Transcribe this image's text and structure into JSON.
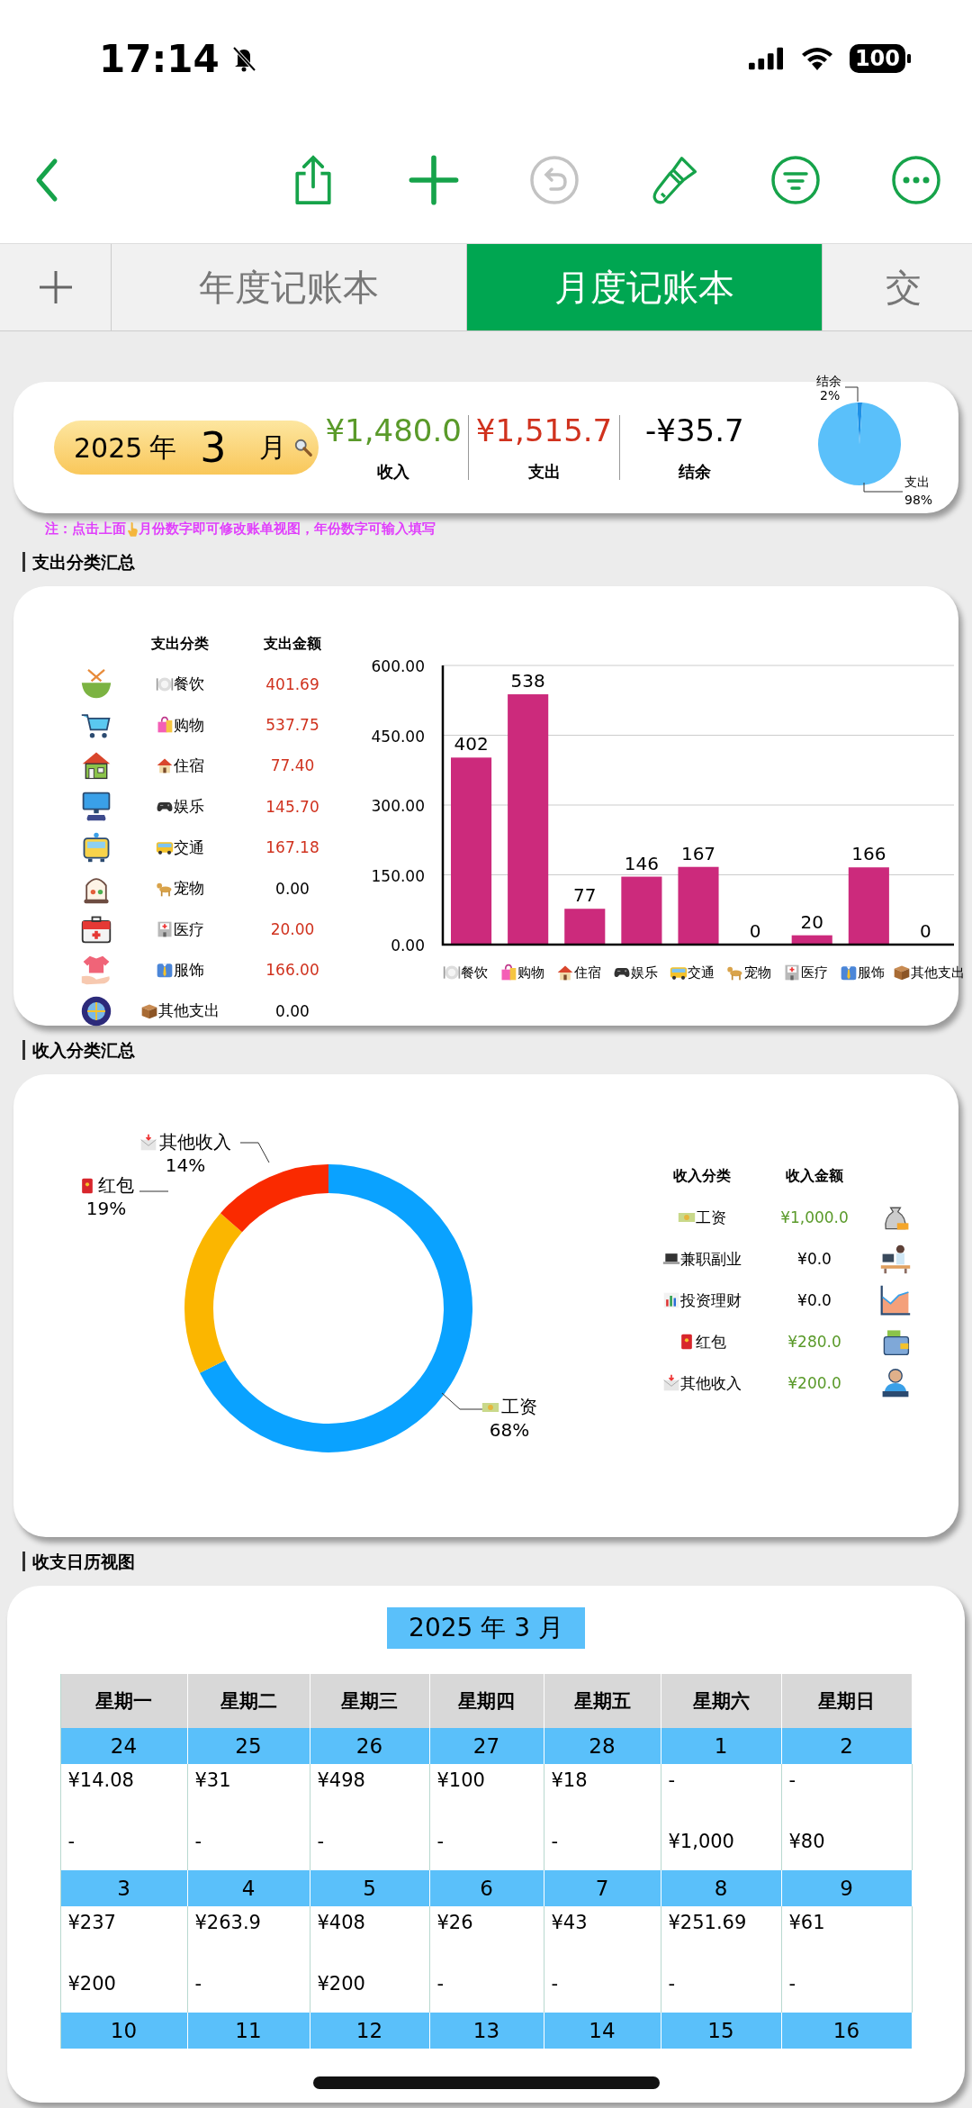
{
  "status_bar": {
    "time": "17:14",
    "battery": "100"
  },
  "toolbar": [
    {
      "kind": "back",
      "disabled": false
    },
    {
      "kind": "share",
      "disabled": false
    },
    {
      "kind": "add",
      "disabled": false
    },
    {
      "kind": "undo",
      "disabled": true
    },
    {
      "kind": "brush",
      "disabled": false
    },
    {
      "kind": "filter",
      "disabled": false
    },
    {
      "kind": "more",
      "disabled": false
    }
  ],
  "tabs": [
    {
      "kind": "add",
      "selected": false
    },
    {
      "kind": "sheet",
      "label": "年度记账本",
      "selected": false
    },
    {
      "kind": "sheet",
      "label": "月度记账本",
      "selected": true
    },
    {
      "kind": "sheet",
      "label": "交",
      "selected": false
    }
  ],
  "summary": {
    "year": "2025",
    "year_unit": "年",
    "month": "3",
    "month_unit": "月",
    "totals": [
      {
        "kind": "income",
        "value": "¥1,480.0",
        "label": "收入"
      },
      {
        "kind": "expense",
        "value": "¥1,515.7",
        "label": "支出"
      },
      {
        "kind": "balance",
        "value": "-¥35.7",
        "label": "结余"
      }
    ],
    "chart_data": {
      "type": "pie",
      "categories": [
        "结余",
        "支出"
      ],
      "values": [
        2,
        98
      ],
      "colors": [
        "#1e90e6",
        "#5ac0fa"
      ],
      "value_labels": [
        "2%",
        "98%"
      ]
    }
  },
  "note": {
    "before": "注：点击上面",
    "after": "月份数字即可修改账单视图，年份数字可输入填写"
  },
  "expense_section": {
    "title": "支出分类汇总",
    "columns": [
      "支出分类",
      "支出金额"
    ],
    "rows": [
      {
        "category": "餐饮",
        "amount": "401.69",
        "highlight": true
      },
      {
        "category": "购物",
        "amount": "537.75",
        "highlight": true
      },
      {
        "category": "住宿",
        "amount": "77.40",
        "highlight": true
      },
      {
        "category": "娱乐",
        "amount": "145.70",
        "highlight": true
      },
      {
        "category": "交通",
        "amount": "167.18",
        "highlight": true
      },
      {
        "category": "宠物",
        "amount": "0.00",
        "highlight": false
      },
      {
        "category": "医疗",
        "amount": "20.00",
        "highlight": true
      },
      {
        "category": "服饰",
        "amount": "166.00",
        "highlight": true
      },
      {
        "category": "其他支出",
        "amount": "0.00",
        "highlight": false
      }
    ],
    "chart_data": {
      "type": "bar",
      "categories": [
        "餐饮",
        "购物",
        "住宿",
        "娱乐",
        "交通",
        "宠物",
        "医疗",
        "服饰",
        "其他支出"
      ],
      "series": [
        {
          "color": "#cc2a7c",
          "values": [
            402,
            538,
            77,
            146,
            167,
            0,
            20,
            166,
            0
          ]
        }
      ],
      "grid": true,
      "value_labels": [
        "402",
        "538",
        "77",
        "146",
        "167",
        "0",
        "20",
        "166",
        "0"
      ],
      "ylim": [
        0,
        600
      ],
      "yticks": [
        {
          "value": 0,
          "label": "0.00"
        },
        {
          "value": 150,
          "label": "150.00"
        },
        {
          "value": 300,
          "label": "300.00"
        },
        {
          "value": 450,
          "label": "450.00"
        },
        {
          "value": 600,
          "label": "600.00"
        }
      ]
    }
  },
  "income_section": {
    "title": "收入分类汇总",
    "columns": [
      "收入分类",
      "收入金额"
    ],
    "rows": [
      {
        "category": "工资",
        "amount": "¥1,000.0",
        "highlight": true
      },
      {
        "category": "兼职副业",
        "amount": "¥0.0",
        "highlight": false
      },
      {
        "category": "投资理财",
        "amount": "¥0.0",
        "highlight": false
      },
      {
        "category": "红包",
        "amount": "¥280.0",
        "highlight": true
      },
      {
        "category": "其他收入",
        "amount": "¥200.0",
        "highlight": true
      }
    ],
    "chart_data": {
      "type": "donut",
      "categories": [
        "工资",
        "红包",
        "其他收入"
      ],
      "series": [
        {
          "values": [
            67.6,
            18.9,
            13.5
          ]
        }
      ],
      "colors": [
        "#0aa2ff",
        "#fbb600",
        "#fa2a00"
      ],
      "value_labels": [
        "68%",
        "19%",
        "14%"
      ]
    }
  },
  "calendar_section": {
    "title": "收支日历视图",
    "heading": "2025 年 3 月",
    "weekdays": [
      "星期一",
      "星期二",
      "星期三",
      "星期四",
      "星期五",
      "星期六",
      "星期日"
    ],
    "weeks": [
      {
        "days": [
          {
            "day": "24",
            "expense": "¥14.08",
            "income": "-"
          },
          {
            "day": "25",
            "expense": "¥31",
            "income": "-"
          },
          {
            "day": "26",
            "expense": "¥498",
            "income": "-"
          },
          {
            "day": "27",
            "expense": "¥100",
            "income": "-"
          },
          {
            "day": "28",
            "expense": "¥18",
            "income": "-"
          },
          {
            "day": "1",
            "expense": "-",
            "income": "¥1,000"
          },
          {
            "day": "2",
            "expense": "-",
            "income": "¥80"
          }
        ]
      },
      {
        "days": [
          {
            "day": "3",
            "expense": "¥237",
            "income": "¥200"
          },
          {
            "day": "4",
            "expense": "¥263.9",
            "income": "-"
          },
          {
            "day": "5",
            "expense": "¥408",
            "income": "¥200"
          },
          {
            "day": "6",
            "expense": "¥26",
            "income": "-"
          },
          {
            "day": "7",
            "expense": "¥43",
            "income": "-"
          },
          {
            "day": "8",
            "expense": "¥251.69",
            "income": "-"
          },
          {
            "day": "9",
            "expense": "¥61",
            "income": "-"
          }
        ]
      },
      {
        "days": [
          {
            "day": "10"
          },
          {
            "day": "11"
          },
          {
            "day": "12"
          },
          {
            "day": "13"
          },
          {
            "day": "14"
          },
          {
            "day": "15"
          },
          {
            "day": "16"
          }
        ]
      }
    ]
  }
}
